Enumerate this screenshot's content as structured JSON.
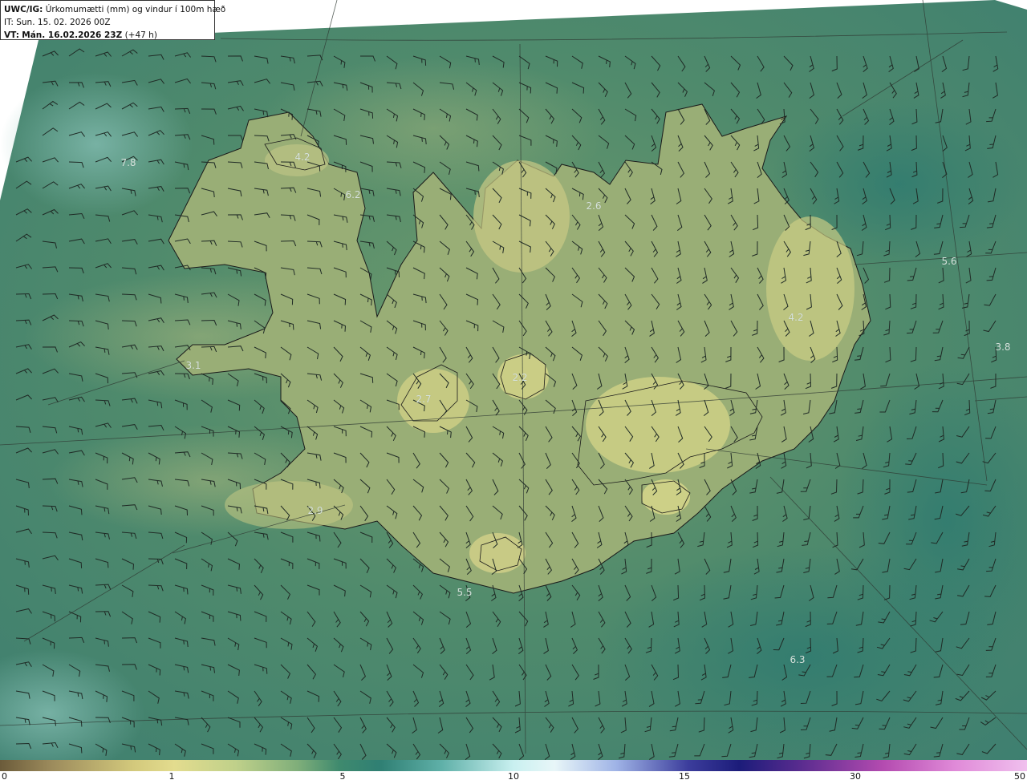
{
  "header": {
    "model": "UWC/IG:",
    "product": "Úrkomumætti (mm) og vindur í 100m hæð",
    "initial_time": "IT: Sun. 15. 02. 2026 00Z",
    "valid_prefix": "VT:",
    "valid_time": "Mán. 16.02.2026 23Z",
    "lead": "(+47 h)"
  },
  "map": {
    "values": [
      {
        "id": "v1",
        "text": "4.2"
      },
      {
        "id": "v2",
        "text": "7.8"
      },
      {
        "id": "v3",
        "text": "6.2"
      },
      {
        "id": "v4",
        "text": "2.6"
      },
      {
        "id": "v5",
        "text": "5.6"
      },
      {
        "id": "v6",
        "text": "4.2"
      },
      {
        "id": "v7",
        "text": "3.8"
      },
      {
        "id": "v8",
        "text": "3.1"
      },
      {
        "id": "v9",
        "text": "2.7"
      },
      {
        "id": "v10",
        "text": "2.2"
      },
      {
        "id": "v11",
        "text": "2.9"
      },
      {
        "id": "v12",
        "text": "5.5"
      },
      {
        "id": "v13",
        "text": "6.3"
      }
    ]
  },
  "colorbar": {
    "ticks": [
      "0",
      "1",
      "5",
      "10",
      "15",
      "30",
      "50"
    ],
    "colors": [
      "#6b5b3a",
      "#9c8b5c",
      "#d3c97c",
      "#e3dc8e",
      "#bfd08a",
      "#7fae7a",
      "#3f8a6e",
      "#2f7f73",
      "#5fb0a8",
      "#c9f0f0",
      "#e8f6f8",
      "#9fb3e6",
      "#3c3d9c",
      "#1c1c7a",
      "#5a2c8f",
      "#b44bb0",
      "#e08ad8",
      "#f0c0ee"
    ],
    "stops": [
      0,
      0.05,
      0.13,
      0.17,
      0.23,
      0.29,
      0.33,
      0.37,
      0.43,
      0.5,
      0.54,
      0.6,
      0.67,
      0.72,
      0.78,
      0.86,
      0.93,
      1
    ]
  }
}
